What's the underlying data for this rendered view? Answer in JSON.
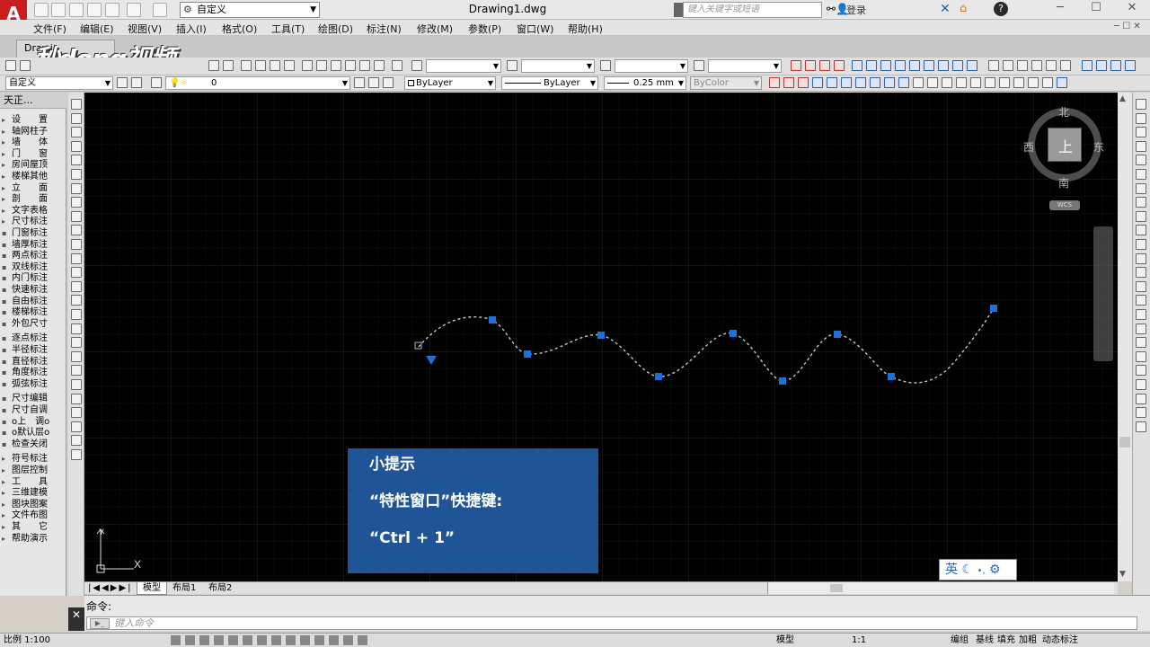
{
  "titlebar": {
    "document_title": "Drawing1.dwg",
    "workspace": "自定义",
    "search_placeholder": "键入关键字或短语",
    "login_label": "登录"
  },
  "menubar": {
    "items": [
      "文件(F)",
      "编辑(E)",
      "视图(V)",
      "插入(I)",
      "格式(O)",
      "工具(T)",
      "绘图(D)",
      "标注(N)",
      "修改(M)",
      "参数(P)",
      "窗口(W)",
      "帮助(H)"
    ]
  },
  "document_tab": {
    "label": "Drawi"
  },
  "watermark": {
    "text": "秒dong视频"
  },
  "properties": {
    "workspace2": "自定义",
    "layer": "0",
    "color": "ByLayer",
    "linetype": "ByLayer",
    "lineweight": "0.25 mm",
    "plotstyle": "ByColor"
  },
  "side_panel": {
    "title": "天正...",
    "items": [
      "设　　置",
      "轴网柱子",
      "墙　　体",
      "门　　窗",
      "房间屋顶",
      "楼梯其他",
      "立　　面",
      "剖　　面",
      "文字表格",
      "尺寸标注",
      "门窗标注",
      "墙厚标注",
      "两点标注",
      "双线标注",
      "内门标注",
      "快速标注",
      "自由标注",
      "楼梯标注",
      "外包尺寸",
      "逐点标注",
      "半径标注",
      "直径标注",
      "角度标注",
      "弧弦标注",
      "尺寸编辑",
      "尺寸自调",
      "o上　调o",
      "o默认层o",
      "检查关闭",
      "符号标注",
      "图层控制",
      "工　　具",
      "三维建模",
      "图块图案",
      "文件布图",
      "其　　它",
      "帮助演示"
    ]
  },
  "viewcube": {
    "north": "北",
    "south": "南",
    "east": "东",
    "west": "西",
    "top": "上",
    "wcs": "WCS"
  },
  "ucs_icon": {
    "x_label": "X",
    "y_label": "Y"
  },
  "tip_box": {
    "title": "小提示",
    "line1": "“特性窗口”快捷键:",
    "line2": "“Ctrl + 1”"
  },
  "ime": {
    "text": "英"
  },
  "layout_tabs": {
    "items": [
      "模型",
      "布局1",
      "布局2"
    ]
  },
  "command": {
    "history": "命令:",
    "placeholder": "键入命令"
  },
  "statusbar": {
    "scale": "比例 1:100",
    "model": "模型",
    "annotation_scale": "1:1",
    "right_items": [
      "编组",
      "基线",
      "填充",
      "加粗",
      "动态标注"
    ]
  },
  "spline": {
    "color": "#c8c8c8",
    "grip_color": "#1e6fd9"
  }
}
